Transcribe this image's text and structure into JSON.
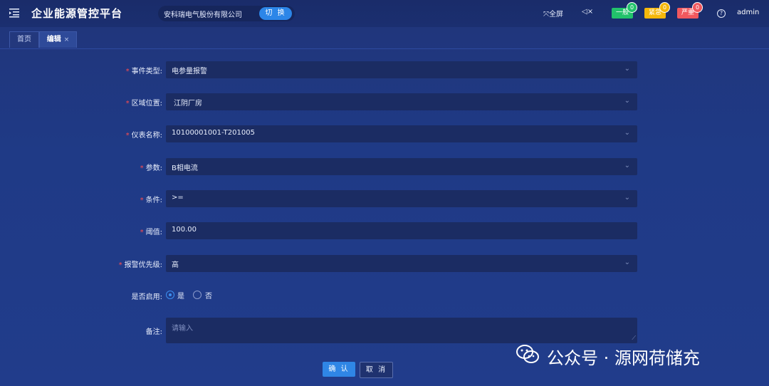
{
  "header": {
    "title": "企业能源管控平台",
    "company": "安科瑞电气股份有限公司",
    "switch_label": "切 换",
    "fullscreen_label": "全屏",
    "mute_label": "◁×",
    "alerts": [
      {
        "label": "一般",
        "count": "0",
        "color": "#22c26b"
      },
      {
        "label": "紧急",
        "count": "0",
        "color": "#f5b70a"
      },
      {
        "label": "严重",
        "count": "0",
        "color": "#f0585e"
      }
    ],
    "help": "?",
    "user": "admin"
  },
  "tabs": [
    {
      "label": "首页"
    },
    {
      "label": "编辑",
      "close": "×"
    }
  ],
  "form": {
    "event_type": {
      "label": "事件类型:",
      "value": "电参量报警"
    },
    "area": {
      "label": "区域位置:",
      "value": "江阴厂房"
    },
    "meter": {
      "label": "仪表名称:",
      "value": "10100001001-T201005"
    },
    "param": {
      "label": "参数:",
      "value": "B相电流"
    },
    "condition": {
      "label": "条件:",
      "value": ">="
    },
    "threshold": {
      "label": "阈值:",
      "value": "100.00"
    },
    "priority": {
      "label": "报警优先级:",
      "value": "高"
    },
    "enabled": {
      "label": "是否启用:",
      "yes": "是",
      "no": "否",
      "selected": "是"
    },
    "remark": {
      "label": "备注:",
      "placeholder": "请输入"
    },
    "required_mark": "*"
  },
  "buttons": {
    "confirm": "确 认",
    "cancel": "取 消"
  },
  "watermark": "公众号 · 源网荷储充"
}
